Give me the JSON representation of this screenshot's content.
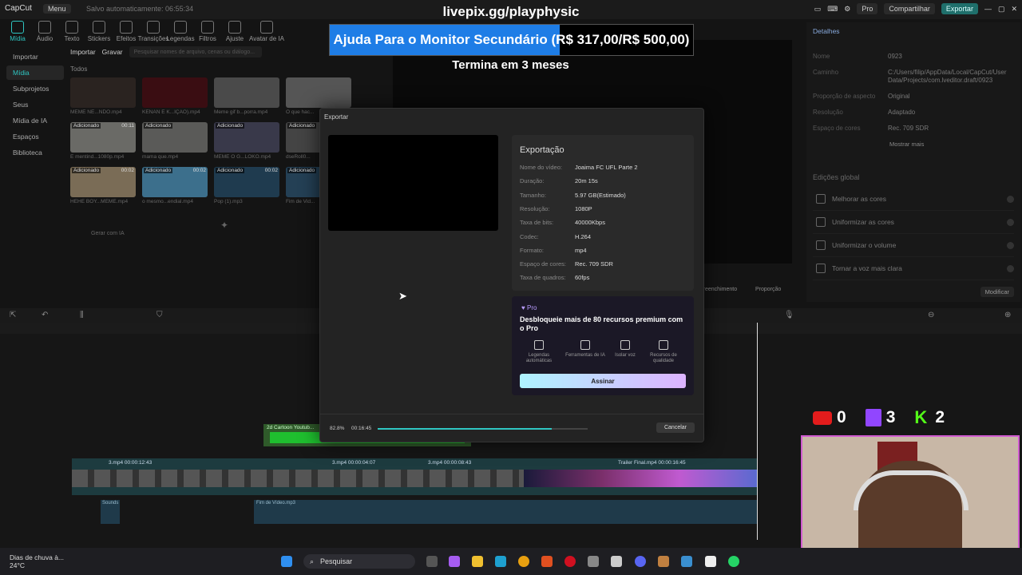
{
  "app": {
    "logo": "CapCut",
    "menu": "Menu",
    "autosave": "Salvo automaticamente: 06:55:34",
    "pro": "Pro",
    "share": "Compartilhar",
    "export": "Exportar"
  },
  "toolbar": [
    "Mídia",
    "Áudio",
    "Texto",
    "Stickers",
    "Efeitos",
    "Transições",
    "Legendas",
    "Filtros",
    "Ajuste",
    "Avatar de IA"
  ],
  "leftnav": [
    "Importar",
    "Mídia",
    "Subprojetos",
    "Seus",
    "Mídia de IA",
    "Espaços",
    "Biblioteca"
  ],
  "media": {
    "import": "Importar",
    "record": "Gravar",
    "search_placeholder": "Pesquisar nomes de arquivo, cenas ou diálogo...",
    "all": "Todos",
    "add_ai": "Gerar com IA",
    "items": [
      {
        "tag": "",
        "dur": "",
        "name": "MEME NE...NDO.mp4",
        "color": "#2a2320"
      },
      {
        "tag": "",
        "dur": "",
        "name": "KENAN E K...IÇÃO).mp4",
        "color": "#3a0d12"
      },
      {
        "tag": "",
        "dur": "",
        "name": "Meme gif b...porra.mp4",
        "color": "#4a4a4a"
      },
      {
        "tag": "",
        "dur": "",
        "name": "O que hac...",
        "color": "#555"
      },
      {
        "tag": "Adicionado",
        "dur": "00:11",
        "name": "E mentind...1080p.mp4",
        "color": "#6a6a66"
      },
      {
        "tag": "Adicionado",
        "dur": "",
        "name": "mama que.mp4",
        "color": "#5a5a58"
      },
      {
        "tag": "Adicionado",
        "dur": "",
        "name": "MEME O G...LOKO.mp4",
        "color": "#39394a"
      },
      {
        "tag": "Adicionado",
        "dur": "",
        "name": "dseRoll0...",
        "color": "#444"
      },
      {
        "tag": "Adicionado",
        "dur": "00:02",
        "name": "HEHE BOY...MEME.mp4",
        "color": "#7a6c56"
      },
      {
        "tag": "Adicionado",
        "dur": "00:02",
        "name": "o mesmo...endial.mp4",
        "color": "#3c6f8c"
      },
      {
        "tag": "Adicionado",
        "dur": "00:02",
        "name": "Pop (1).mp3",
        "color": "#1f3b4f"
      },
      {
        "tag": "Adicionado",
        "dur": "",
        "name": "Fim de Vid...",
        "color": "#244055"
      }
    ]
  },
  "details": {
    "title": "Detalhes",
    "rows": [
      {
        "k": "Nome",
        "v": "0923"
      },
      {
        "k": "Caminho",
        "v": "C:/Users/filip/AppData/Local/CapCut/User Data/Projects/com.lveditor.draft/0923"
      },
      {
        "k": "Proporção de aspecto",
        "v": "Original"
      },
      {
        "k": "Resolução",
        "v": "Adaptado"
      },
      {
        "k": "Espaço de cores",
        "v": "Rec. 709 SDR"
      }
    ],
    "more": "Mostrar mais",
    "global_title": "Edições global",
    "global": [
      "Melhorar as cores",
      "Uniformizar as cores",
      "Uniformizar o volume",
      "Tornar a voz mais clara"
    ],
    "modify": "Modificar"
  },
  "player": {
    "fill": "Preenchimento",
    "ratio": "Proporção"
  },
  "timeline": {
    "clips": [
      {
        "label": "3.mp4 00:00:12:43"
      },
      {
        "label": "3.mp4 00:00:04:07"
      },
      {
        "label": "3.mp4 00:00:08:43"
      },
      {
        "label": "Trailer Final.mp4 00:00:16:45"
      }
    ],
    "green_label": "2d Cartoon Youtub...",
    "audio1": "Sounds",
    "audio2": "Fim de Vídeo.mp3"
  },
  "dialog": {
    "title": "Exportar",
    "section": "Exportação",
    "rows": [
      {
        "k": "Nome do vídeo:",
        "v": "Joaima FC UFL Parte 2"
      },
      {
        "k": "Duração:",
        "v": "20m 15s"
      },
      {
        "k": "Tamanho:",
        "v": "5.97 GB(Estimado)"
      },
      {
        "k": "Resolução:",
        "v": "1080P"
      },
      {
        "k": "Taxa de bits:",
        "v": "40000Kbps"
      },
      {
        "k": "Codec:",
        "v": "H.264"
      },
      {
        "k": "Formato:",
        "v": "mp4"
      },
      {
        "k": "Espaço de cores:",
        "v": "Rec. 709 SDR"
      },
      {
        "k": "Taxa de quadros:",
        "v": "60fps"
      }
    ],
    "pro_badge": "Pro",
    "pro_text": "Desbloqueie mais de 80 recursos premium com o Pro",
    "features": [
      "Legendas automáticas",
      "Ferramentas de IA",
      "Isolar voz",
      "Recursos de qualidade"
    ],
    "subscribe": "Assinar",
    "progress_text": "82.8%",
    "progress": 0.828,
    "elapsed": "00:16:45",
    "cancel": "Cancelar"
  },
  "overlay": {
    "url": "livepix.gg/playphysic",
    "goal": "Ajuda Para o Monitor Secundário (R$ 317,00/R$ 500,00)",
    "goal_progress": 0.634,
    "ends": "Termina em 3 meses",
    "youtube": "0",
    "twitch": "3",
    "kick": "2"
  },
  "taskbar": {
    "weather": "Dias de chuva à...",
    "temp": "24°C",
    "search": "Pesquisar"
  }
}
